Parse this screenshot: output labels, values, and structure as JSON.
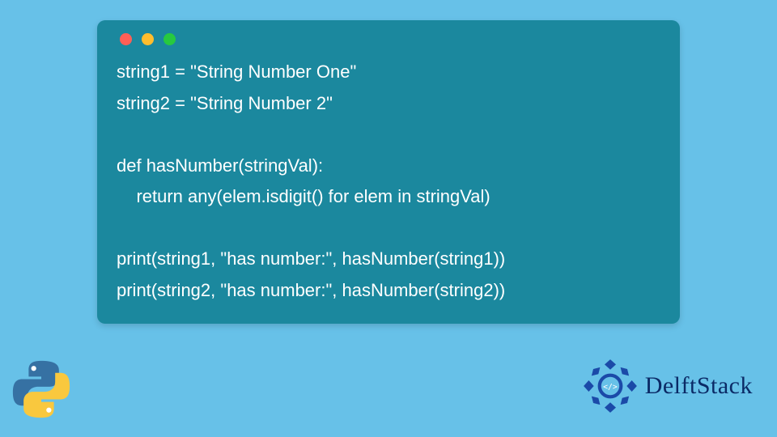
{
  "card": {
    "dots": [
      "#ff5f56",
      "#ffbd2e",
      "#27c93f"
    ],
    "bg": "#1b889e"
  },
  "code": {
    "lines": [
      "string1 = \"String Number One\"",
      "string2 = \"String Number 2\"",
      "",
      "def hasNumber(stringVal):",
      "    return any(elem.isdigit() for elem in stringVal)",
      "",
      "print(string1, \"has number:\", hasNumber(string1))",
      "print(string2, \"has number:\", hasNumber(string2))"
    ]
  },
  "brand": {
    "name": "DelftStack",
    "color": "#0b2a66"
  },
  "icons": {
    "python": "python-logo",
    "brand": "delftstack-logo"
  }
}
